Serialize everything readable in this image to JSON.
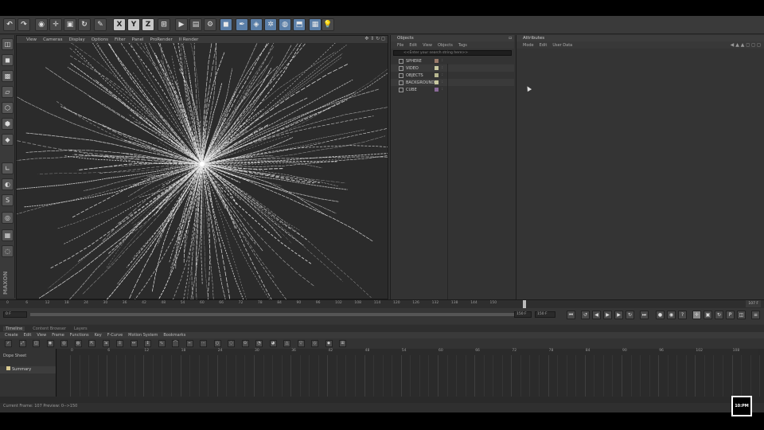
{
  "toolbar": {
    "items": [
      {
        "icon": "undo-icon",
        "glyph": "↶"
      },
      {
        "icon": "redo-icon",
        "glyph": "↷"
      },
      {
        "icon": "live-selection-icon",
        "glyph": "◉"
      },
      {
        "icon": "move-icon",
        "glyph": "✛"
      },
      {
        "icon": "scale-icon",
        "glyph": "▣"
      },
      {
        "icon": "rotate-icon",
        "glyph": "↻"
      },
      {
        "icon": "recent-tools-icon",
        "glyph": "✎"
      },
      {
        "icon": "x-axis-icon",
        "glyph": "X"
      },
      {
        "icon": "y-axis-icon",
        "glyph": "Y"
      },
      {
        "icon": "z-axis-icon",
        "glyph": "Z"
      },
      {
        "icon": "coordinate-system-icon",
        "glyph": "⊞"
      },
      {
        "icon": "render-view-icon",
        "glyph": "▶"
      },
      {
        "icon": "render-picture-viewer-icon",
        "glyph": "▤"
      },
      {
        "icon": "render-settings-icon",
        "glyph": "⚙"
      },
      {
        "icon": "cube-icon",
        "glyph": "◼"
      },
      {
        "icon": "pen-icon",
        "glyph": "✒"
      },
      {
        "icon": "subdivision-icon",
        "glyph": "◈"
      },
      {
        "icon": "array-icon",
        "glyph": "✲"
      },
      {
        "icon": "deformer-icon",
        "glyph": "◍"
      },
      {
        "icon": "floor-icon",
        "glyph": "⬒"
      },
      {
        "icon": "camera-icon",
        "glyph": "▦"
      },
      {
        "icon": "light-icon",
        "glyph": "💡"
      }
    ]
  },
  "viewport": {
    "menu": [
      "View",
      "Cameras",
      "Display",
      "Options",
      "Filter",
      "Panel",
      "ProRender",
      "II Render"
    ]
  },
  "objects": {
    "title": "Objects",
    "menu": [
      "File",
      "Edit",
      "View",
      "Objects",
      "Tags"
    ],
    "search_placeholder": "<<Enter your search string here>>",
    "rows": [
      {
        "name": "SPHERE",
        "color": "#9a7a6a"
      },
      {
        "name": "VIDEO",
        "color": "#c8c8a0"
      },
      {
        "name": "OBJECTS",
        "color": "#b8b890"
      },
      {
        "name": "BACKGROUND",
        "color": "#c8c8a0"
      },
      {
        "name": "CUBE",
        "color": "#8a6a9a"
      }
    ]
  },
  "attributes": {
    "title": "Attributes",
    "menu": [
      "Mode",
      "Edit",
      "User Data"
    ]
  },
  "timeline_ruler": {
    "ticks": [
      0,
      6,
      12,
      18,
      24,
      30,
      36,
      42,
      48,
      54,
      60,
      66,
      72,
      78,
      84,
      90,
      96,
      102,
      108,
      114,
      120,
      126,
      132,
      138,
      144,
      150
    ],
    "fps_label": "107 F"
  },
  "transport": {
    "start_field": "0 F",
    "end_field": "150 F",
    "end_field2": "150 F"
  },
  "timeline_panel": {
    "tabs": [
      "Timeline",
      "Content Browser",
      "Layers"
    ],
    "menu": [
      "Create",
      "Edit",
      "View",
      "Frame",
      "Functions",
      "Key",
      "F-Curve",
      "Motion System",
      "Bookmarks"
    ],
    "sheet_title": "Dope Sheet",
    "summary_label": "Summary",
    "grid_labels": [
      0,
      6,
      12,
      18,
      24,
      30,
      36,
      42,
      48,
      54,
      60,
      66,
      72,
      78,
      84,
      90,
      96,
      102,
      108
    ],
    "status": "Current Frame: 107   Preview: 0-->150"
  },
  "clock": "10:PM"
}
